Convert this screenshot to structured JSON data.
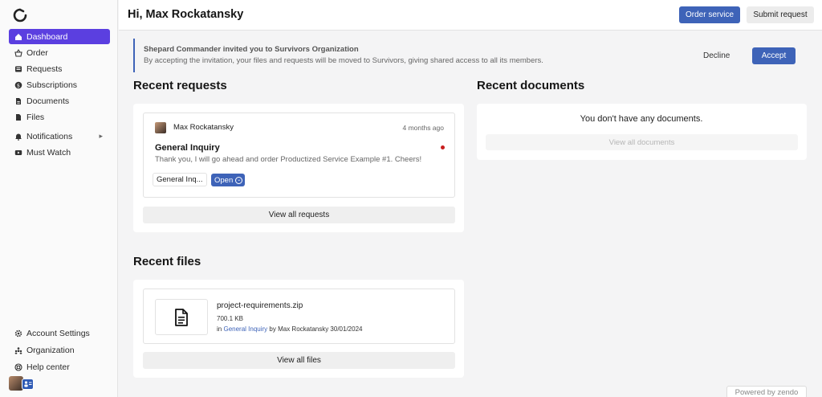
{
  "sidebar": {
    "items": [
      {
        "label": "Dashboard",
        "icon": "home-icon",
        "active": true
      },
      {
        "label": "Order",
        "icon": "basket-icon"
      },
      {
        "label": "Requests",
        "icon": "inbox-icon"
      },
      {
        "label": "Subscriptions",
        "icon": "dollar-circle-icon"
      },
      {
        "label": "Documents",
        "icon": "document-icon"
      },
      {
        "label": "Files",
        "icon": "file-icon"
      },
      {
        "label": "Notifications",
        "icon": "bell-icon"
      },
      {
        "label": "Must Watch",
        "icon": "video-icon"
      }
    ],
    "bottom": [
      {
        "label": "Account Settings",
        "icon": "gear-icon"
      },
      {
        "label": "Organization",
        "icon": "users-icon"
      },
      {
        "label": "Help center",
        "icon": "lifebuoy-icon"
      }
    ]
  },
  "header": {
    "greeting": "Hi, Max Rockatansky",
    "order_label": "Order service",
    "submit_label": "Submit request"
  },
  "invitation": {
    "title": "Shepard Commander invited you to Survivors Organization",
    "text": "By accepting the invitation, your files and requests will be moved to Survivors, giving shared access to all its members.",
    "decline_label": "Decline",
    "accept_label": "Accept"
  },
  "recent_requests": {
    "title": "Recent requests",
    "item": {
      "author": "Max Rockatansky",
      "time": "4 months ago",
      "title": "General Inquiry",
      "message": "Thank you, I will go ahead and order Productized Service Example #1. Cheers!",
      "tag": "General Inq...",
      "status": "Open"
    },
    "view_all_label": "View all requests"
  },
  "recent_documents": {
    "title": "Recent documents",
    "empty_text": "You don't have any documents.",
    "view_all_label": "View all documents"
  },
  "recent_files": {
    "title": "Recent files",
    "file": {
      "name": "project-requirements.zip",
      "size": "700.1 KB",
      "prefix": "in",
      "link": "General Inquiry",
      "by": "by Max Rockatansky 30/01/2024"
    },
    "view_all_label": "View all files"
  },
  "footer": {
    "powered": "Powered by zendo"
  },
  "colors": {
    "accent": "#5b3fe0",
    "primary": "#3e63b8",
    "unread_dot": "#c81e1e"
  }
}
